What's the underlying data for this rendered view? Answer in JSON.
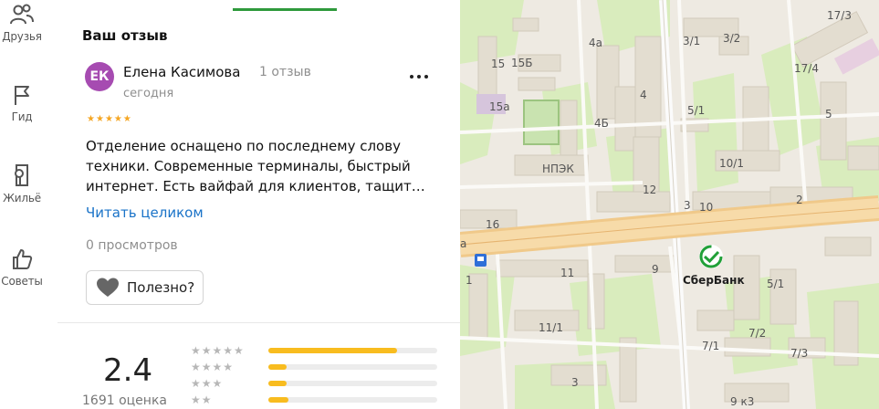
{
  "nav": {
    "friends": "Друзья",
    "guide": "Гид",
    "housing": "Жильё",
    "tips": "Советы"
  },
  "panel": {
    "section_title": "Ваш отзыв"
  },
  "review": {
    "avatar_initials": "ЕК",
    "author": "Елена Касимова",
    "author_reviews": "1 отзыв",
    "date": "сегодня",
    "stars": 5,
    "text": "Отделение оснащено по последнему слову техники. Современные терминалы, быстрый интернет. Есть вайфай для клиентов, тащит…",
    "read_more": "Читать целиком",
    "views": "0 просмотров",
    "helpful": "Полезно?"
  },
  "rating": {
    "value": "2.4",
    "count": "1691 оценка",
    "distribution": [
      {
        "stars": 5,
        "fraction": 0.76
      },
      {
        "stars": 4,
        "fraction": 0.11
      },
      {
        "stars": 3,
        "fraction": 0.11
      },
      {
        "stars": 2,
        "fraction": 0.12
      }
    ]
  },
  "map": {
    "poi": "СберБанк",
    "labels": [
      "17/3",
      "4а",
      "3/1",
      "3/2",
      "17/4",
      "15",
      "15Б",
      "15а",
      "4",
      "4Б",
      "5/1",
      "5",
      "НПЭК",
      "10/1",
      "12",
      "3",
      "10",
      "2",
      "16",
      "а",
      "1",
      "11",
      "9",
      "5/1",
      "11/1",
      "7/2",
      "7/1",
      "7/3",
      "3",
      "9 к3"
    ]
  },
  "colors": {
    "accent_green": "#2e9a3c",
    "link_blue": "#1a73c8",
    "star_orange": "#f5a623",
    "bar_yellow": "#f8bc1f",
    "avatar_purple": "#a64bb1"
  }
}
